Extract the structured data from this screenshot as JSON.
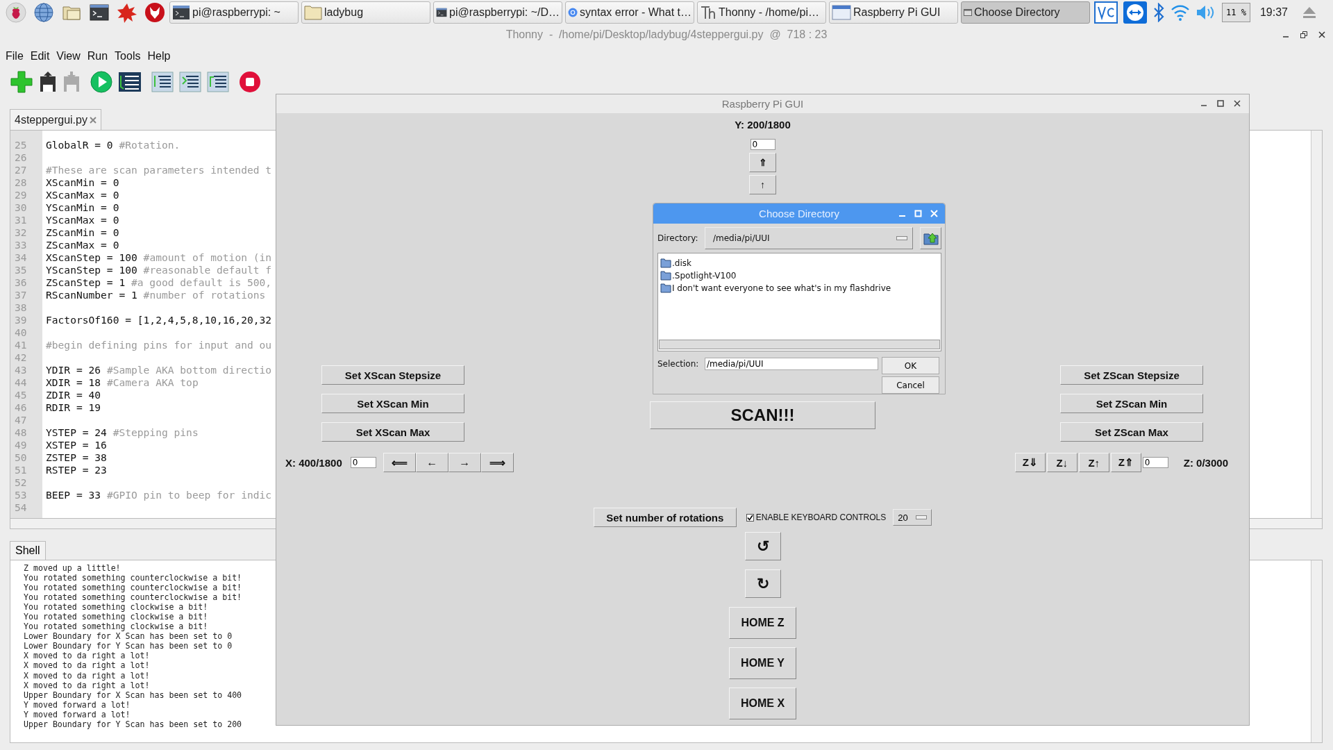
{
  "taskbar": {
    "tasks": [
      {
        "kind": "terminal",
        "label": "pi@raspberrypi: ~",
        "selected": false
      },
      {
        "kind": "folder",
        "label": "ladybug",
        "selected": false
      },
      {
        "kind": "terminal",
        "label": "pi@raspberrypi: ~/D…",
        "selected": false
      },
      {
        "kind": "browser",
        "label": "syntax error - What t…",
        "selected": false
      },
      {
        "kind": "thonny",
        "label": "Thonny  -  /home/pi…",
        "selected": false
      },
      {
        "kind": "window",
        "label": "Raspberry Pi GUI",
        "selected": false
      },
      {
        "kind": "small-window",
        "label": "Choose Directory",
        "selected": true
      }
    ],
    "cpu": "11 %",
    "clock": "19:37"
  },
  "thonny": {
    "title": "Thonny  -  /home/pi/Desktop/ladybug/4steppergui.py  @  718 : 23",
    "menu": [
      "File",
      "Edit",
      "View",
      "Run",
      "Tools",
      "Help"
    ],
    "editor_tab": "4steppergui.py",
    "code_lines": [
      {
        "number": "25",
        "code": "GlobalR = 0 ",
        "comment": "#Rotation."
      },
      {
        "number": "26"
      },
      {
        "number": "27",
        "comment": "#These are scan parameters intended t"
      },
      {
        "number": "28",
        "code": "XScanMin = 0"
      },
      {
        "number": "29",
        "code": "XScanMax = 0"
      },
      {
        "number": "30",
        "code": "YScanMin = 0"
      },
      {
        "number": "31",
        "code": "YScanMax = 0"
      },
      {
        "number": "32",
        "code": "ZScanMin = 0"
      },
      {
        "number": "33",
        "code": "ZScanMax = 0"
      },
      {
        "number": "34",
        "code": "XScanStep = 100 ",
        "comment": "#amount of motion (in"
      },
      {
        "number": "35",
        "code": "YScanStep = 100 ",
        "comment": "#reasonable default f"
      },
      {
        "number": "36",
        "code": "ZScanStep = 1 ",
        "comment": "#a good default is 500,"
      },
      {
        "number": "37",
        "code": "RScanNumber = 1 ",
        "comment": "#number of rotations"
      },
      {
        "number": "38"
      },
      {
        "number": "39",
        "code": "FactorsOf160 = [1,2,4,5,8,10,16,20,32"
      },
      {
        "number": "40"
      },
      {
        "number": "41",
        "comment": "#begin defining pins for input and ou"
      },
      {
        "number": "42"
      },
      {
        "number": "43",
        "code": "YDIR = 26 ",
        "comment": "#Sample AKA bottom directio"
      },
      {
        "number": "44",
        "code": "XDIR = 18 ",
        "comment": "#Camera AKA top"
      },
      {
        "number": "45",
        "code": "ZDIR = 40"
      },
      {
        "number": "46",
        "code": "RDIR = 19"
      },
      {
        "number": "47"
      },
      {
        "number": "48",
        "code": "YSTEP = 24 ",
        "comment": "#Stepping pins"
      },
      {
        "number": "49",
        "code": "XSTEP = 16"
      },
      {
        "number": "50",
        "code": "ZSTEP = 38"
      },
      {
        "number": "51",
        "code": "RSTEP = 23"
      },
      {
        "number": "52"
      },
      {
        "number": "53",
        "code": "BEEP = 33 ",
        "comment": "#GPIO pin to beep for indic"
      },
      {
        "number": "54"
      }
    ],
    "shell_tab": "Shell",
    "shell_lines": [
      "Z moved up a little!",
      "You rotated something counterclockwise a bit!",
      "You rotated something counterclockwise a bit!",
      "You rotated something counterclockwise a bit!",
      "You rotated something clockwise a bit!",
      "You rotated something clockwise a bit!",
      "You rotated something clockwise a bit!",
      "Lower Boundary for X Scan has been set to 0",
      "Lower Boundary for Y Scan has been set to 0",
      "X moved to da right a lot!",
      "X moved to da right a lot!",
      "X moved to da right a lot!",
      "X moved to da right a lot!",
      "Upper Boundary for X Scan has been set to 400",
      "Y moved forward a lot!",
      "Y moved forward a lot!",
      "Upper Boundary for Y Scan has been set to 200"
    ]
  },
  "gui": {
    "title": "Raspberry Pi GUI",
    "y_readout": "Y: 200/1800",
    "y_input": "0",
    "y_buttons": [
      "⇑",
      "↑"
    ],
    "left_buttons": [
      "Set XScan Stepsize",
      "Set XScan Min",
      "Set XScan Max"
    ],
    "x_readout": "X: 400/1800",
    "x_input": "0",
    "x_buttons": [
      "⟸",
      "←",
      "→",
      "⟹"
    ],
    "scan_button": "SCAN!!!",
    "right_buttons": [
      "Set ZScan Stepsize",
      "Set ZScan Min",
      "Set ZScan Max"
    ],
    "z_buttons": [
      "Z⇓",
      "Z↓",
      "Z↑",
      "Z⇑"
    ],
    "z_input": "0",
    "z_readout": "Z: 0/3000",
    "rotations_button": "Set number of rotations",
    "keyboard_checkbox": {
      "label": "ENABLE KEYBOARD CONTROLS",
      "checked": true
    },
    "rotations_spin": "20",
    "rotate_buttons": [
      "↺",
      "↻"
    ],
    "home_buttons": [
      "HOME Z",
      "HOME Y",
      "HOME X"
    ]
  },
  "dialog": {
    "title": "Choose Directory",
    "directory_label": "Directory:",
    "directory": "/media/pi/UUI",
    "folders": [
      ".disk",
      ".Spotlight-V100",
      "I don't want everyone to see what's in my flashdrive"
    ],
    "selection_label": "Selection:",
    "selection": "/media/pi/UUI",
    "buttons": [
      "OK",
      "Cancel"
    ]
  }
}
